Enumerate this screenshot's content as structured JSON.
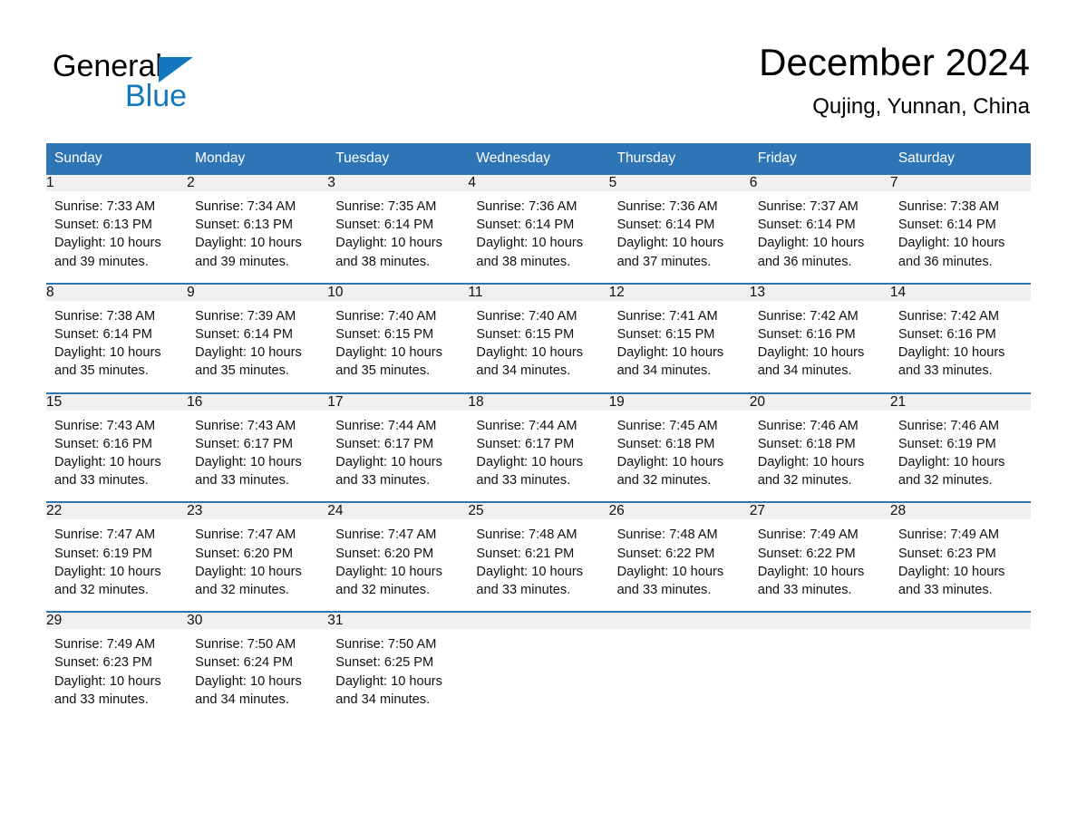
{
  "brand": {
    "name_part1": "General",
    "name_part2": "Blue",
    "accent_color": "#1277bc"
  },
  "header": {
    "title": "December 2024",
    "subtitle": "Qujing, Yunnan, China"
  },
  "theme": {
    "header_blue": "#2e75b6",
    "daynum_gray": "#f0f0f0",
    "separator_blue": "#2e75b6"
  },
  "weekday_headers": [
    "Sunday",
    "Monday",
    "Tuesday",
    "Wednesday",
    "Thursday",
    "Friday",
    "Saturday"
  ],
  "weeks": [
    [
      {
        "day": "1",
        "sunrise": "Sunrise: 7:33 AM",
        "sunset": "Sunset: 6:13 PM",
        "daylight_line1": "Daylight: 10 hours",
        "daylight_line2": "and 39 minutes."
      },
      {
        "day": "2",
        "sunrise": "Sunrise: 7:34 AM",
        "sunset": "Sunset: 6:13 PM",
        "daylight_line1": "Daylight: 10 hours",
        "daylight_line2": "and 39 minutes."
      },
      {
        "day": "3",
        "sunrise": "Sunrise: 7:35 AM",
        "sunset": "Sunset: 6:14 PM",
        "daylight_line1": "Daylight: 10 hours",
        "daylight_line2": "and 38 minutes."
      },
      {
        "day": "4",
        "sunrise": "Sunrise: 7:36 AM",
        "sunset": "Sunset: 6:14 PM",
        "daylight_line1": "Daylight: 10 hours",
        "daylight_line2": "and 38 minutes."
      },
      {
        "day": "5",
        "sunrise": "Sunrise: 7:36 AM",
        "sunset": "Sunset: 6:14 PM",
        "daylight_line1": "Daylight: 10 hours",
        "daylight_line2": "and 37 minutes."
      },
      {
        "day": "6",
        "sunrise": "Sunrise: 7:37 AM",
        "sunset": "Sunset: 6:14 PM",
        "daylight_line1": "Daylight: 10 hours",
        "daylight_line2": "and 36 minutes."
      },
      {
        "day": "7",
        "sunrise": "Sunrise: 7:38 AM",
        "sunset": "Sunset: 6:14 PM",
        "daylight_line1": "Daylight: 10 hours",
        "daylight_line2": "and 36 minutes."
      }
    ],
    [
      {
        "day": "8",
        "sunrise": "Sunrise: 7:38 AM",
        "sunset": "Sunset: 6:14 PM",
        "daylight_line1": "Daylight: 10 hours",
        "daylight_line2": "and 35 minutes."
      },
      {
        "day": "9",
        "sunrise": "Sunrise: 7:39 AM",
        "sunset": "Sunset: 6:14 PM",
        "daylight_line1": "Daylight: 10 hours",
        "daylight_line2": "and 35 minutes."
      },
      {
        "day": "10",
        "sunrise": "Sunrise: 7:40 AM",
        "sunset": "Sunset: 6:15 PM",
        "daylight_line1": "Daylight: 10 hours",
        "daylight_line2": "and 35 minutes."
      },
      {
        "day": "11",
        "sunrise": "Sunrise: 7:40 AM",
        "sunset": "Sunset: 6:15 PM",
        "daylight_line1": "Daylight: 10 hours",
        "daylight_line2": "and 34 minutes."
      },
      {
        "day": "12",
        "sunrise": "Sunrise: 7:41 AM",
        "sunset": "Sunset: 6:15 PM",
        "daylight_line1": "Daylight: 10 hours",
        "daylight_line2": "and 34 minutes."
      },
      {
        "day": "13",
        "sunrise": "Sunrise: 7:42 AM",
        "sunset": "Sunset: 6:16 PM",
        "daylight_line1": "Daylight: 10 hours",
        "daylight_line2": "and 34 minutes."
      },
      {
        "day": "14",
        "sunrise": "Sunrise: 7:42 AM",
        "sunset": "Sunset: 6:16 PM",
        "daylight_line1": "Daylight: 10 hours",
        "daylight_line2": "and 33 minutes."
      }
    ],
    [
      {
        "day": "15",
        "sunrise": "Sunrise: 7:43 AM",
        "sunset": "Sunset: 6:16 PM",
        "daylight_line1": "Daylight: 10 hours",
        "daylight_line2": "and 33 minutes."
      },
      {
        "day": "16",
        "sunrise": "Sunrise: 7:43 AM",
        "sunset": "Sunset: 6:17 PM",
        "daylight_line1": "Daylight: 10 hours",
        "daylight_line2": "and 33 minutes."
      },
      {
        "day": "17",
        "sunrise": "Sunrise: 7:44 AM",
        "sunset": "Sunset: 6:17 PM",
        "daylight_line1": "Daylight: 10 hours",
        "daylight_line2": "and 33 minutes."
      },
      {
        "day": "18",
        "sunrise": "Sunrise: 7:44 AM",
        "sunset": "Sunset: 6:17 PM",
        "daylight_line1": "Daylight: 10 hours",
        "daylight_line2": "and 33 minutes."
      },
      {
        "day": "19",
        "sunrise": "Sunrise: 7:45 AM",
        "sunset": "Sunset: 6:18 PM",
        "daylight_line1": "Daylight: 10 hours",
        "daylight_line2": "and 32 minutes."
      },
      {
        "day": "20",
        "sunrise": "Sunrise: 7:46 AM",
        "sunset": "Sunset: 6:18 PM",
        "daylight_line1": "Daylight: 10 hours",
        "daylight_line2": "and 32 minutes."
      },
      {
        "day": "21",
        "sunrise": "Sunrise: 7:46 AM",
        "sunset": "Sunset: 6:19 PM",
        "daylight_line1": "Daylight: 10 hours",
        "daylight_line2": "and 32 minutes."
      }
    ],
    [
      {
        "day": "22",
        "sunrise": "Sunrise: 7:47 AM",
        "sunset": "Sunset: 6:19 PM",
        "daylight_line1": "Daylight: 10 hours",
        "daylight_line2": "and 32 minutes."
      },
      {
        "day": "23",
        "sunrise": "Sunrise: 7:47 AM",
        "sunset": "Sunset: 6:20 PM",
        "daylight_line1": "Daylight: 10 hours",
        "daylight_line2": "and 32 minutes."
      },
      {
        "day": "24",
        "sunrise": "Sunrise: 7:47 AM",
        "sunset": "Sunset: 6:20 PM",
        "daylight_line1": "Daylight: 10 hours",
        "daylight_line2": "and 32 minutes."
      },
      {
        "day": "25",
        "sunrise": "Sunrise: 7:48 AM",
        "sunset": "Sunset: 6:21 PM",
        "daylight_line1": "Daylight: 10 hours",
        "daylight_line2": "and 33 minutes."
      },
      {
        "day": "26",
        "sunrise": "Sunrise: 7:48 AM",
        "sunset": "Sunset: 6:22 PM",
        "daylight_line1": "Daylight: 10 hours",
        "daylight_line2": "and 33 minutes."
      },
      {
        "day": "27",
        "sunrise": "Sunrise: 7:49 AM",
        "sunset": "Sunset: 6:22 PM",
        "daylight_line1": "Daylight: 10 hours",
        "daylight_line2": "and 33 minutes."
      },
      {
        "day": "28",
        "sunrise": "Sunrise: 7:49 AM",
        "sunset": "Sunset: 6:23 PM",
        "daylight_line1": "Daylight: 10 hours",
        "daylight_line2": "and 33 minutes."
      }
    ],
    [
      {
        "day": "29",
        "sunrise": "Sunrise: 7:49 AM",
        "sunset": "Sunset: 6:23 PM",
        "daylight_line1": "Daylight: 10 hours",
        "daylight_line2": "and 33 minutes."
      },
      {
        "day": "30",
        "sunrise": "Sunrise: 7:50 AM",
        "sunset": "Sunset: 6:24 PM",
        "daylight_line1": "Daylight: 10 hours",
        "daylight_line2": "and 34 minutes."
      },
      {
        "day": "31",
        "sunrise": "Sunrise: 7:50 AM",
        "sunset": "Sunset: 6:25 PM",
        "daylight_line1": "Daylight: 10 hours",
        "daylight_line2": "and 34 minutes."
      },
      {
        "day": "",
        "sunrise": "",
        "sunset": "",
        "daylight_line1": "",
        "daylight_line2": ""
      },
      {
        "day": "",
        "sunrise": "",
        "sunset": "",
        "daylight_line1": "",
        "daylight_line2": ""
      },
      {
        "day": "",
        "sunrise": "",
        "sunset": "",
        "daylight_line1": "",
        "daylight_line2": ""
      },
      {
        "day": "",
        "sunrise": "",
        "sunset": "",
        "daylight_line1": "",
        "daylight_line2": ""
      }
    ]
  ]
}
